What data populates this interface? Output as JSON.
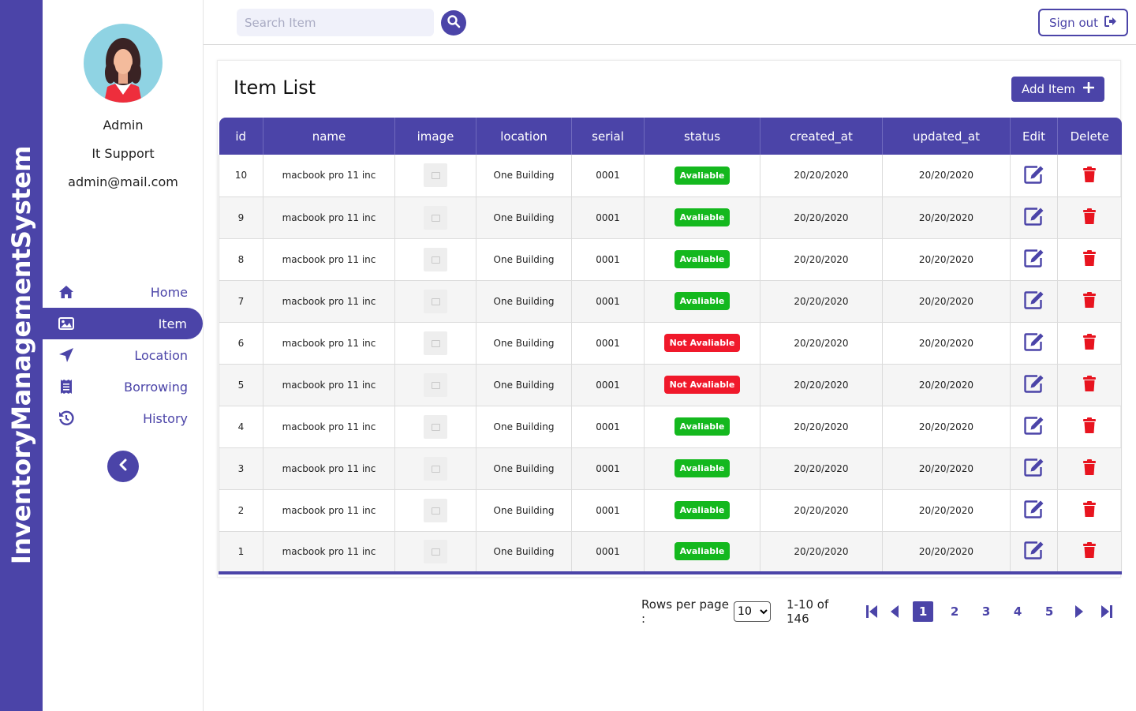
{
  "brand": {
    "name": "InventoryManagementSystem"
  },
  "profile": {
    "name": "Admin",
    "role": "It Support",
    "email": "admin@mail.com"
  },
  "sidebar": {
    "items": [
      {
        "label": "Home",
        "icon": "home-icon"
      },
      {
        "label": "Item",
        "icon": "image-icon",
        "active": true
      },
      {
        "label": "Location",
        "icon": "location-arrow-icon"
      },
      {
        "label": "Borrowing",
        "icon": "receipt-icon"
      },
      {
        "label": "History",
        "icon": "history-icon"
      }
    ]
  },
  "header": {
    "search_placeholder": "Search Item",
    "signout_label": "Sign out"
  },
  "main": {
    "title": "Item List",
    "add_label": "Add Item",
    "columns": [
      "id",
      "name",
      "image",
      "location",
      "serial",
      "status",
      "created_at",
      "updated_at",
      "Edit",
      "Delete"
    ],
    "rows": [
      {
        "id": "10",
        "name": "macbook pro 11 inc",
        "location": "One Building",
        "serial": "0001",
        "status": "Avaliable",
        "available": true,
        "created_at": "20/20/2020",
        "updated_at": "20/20/2020"
      },
      {
        "id": "9",
        "name": "macbook pro 11 inc",
        "location": "One Building",
        "serial": "0001",
        "status": "Avaliable",
        "available": true,
        "created_at": "20/20/2020",
        "updated_at": "20/20/2020"
      },
      {
        "id": "8",
        "name": "macbook pro 11 inc",
        "location": "One Building",
        "serial": "0001",
        "status": "Avaliable",
        "available": true,
        "created_at": "20/20/2020",
        "updated_at": "20/20/2020"
      },
      {
        "id": "7",
        "name": "macbook pro 11 inc",
        "location": "One Building",
        "serial": "0001",
        "status": "Avaliable",
        "available": true,
        "created_at": "20/20/2020",
        "updated_at": "20/20/2020"
      },
      {
        "id": "6",
        "name": "macbook pro 11 inc",
        "location": "One Building",
        "serial": "0001",
        "status": "Not Avaliable",
        "available": false,
        "created_at": "20/20/2020",
        "updated_at": "20/20/2020"
      },
      {
        "id": "5",
        "name": "macbook pro 11 inc",
        "location": "One Building",
        "serial": "0001",
        "status": "Not Avaliable",
        "available": false,
        "created_at": "20/20/2020",
        "updated_at": "20/20/2020"
      },
      {
        "id": "4",
        "name": "macbook pro 11 inc",
        "location": "One Building",
        "serial": "0001",
        "status": "Avaliable",
        "available": true,
        "created_at": "20/20/2020",
        "updated_at": "20/20/2020"
      },
      {
        "id": "3",
        "name": "macbook pro 11 inc",
        "location": "One Building",
        "serial": "0001",
        "status": "Avaliable",
        "available": true,
        "created_at": "20/20/2020",
        "updated_at": "20/20/2020"
      },
      {
        "id": "2",
        "name": "macbook pro 11 inc",
        "location": "One Building",
        "serial": "0001",
        "status": "Avaliable",
        "available": true,
        "created_at": "20/20/2020",
        "updated_at": "20/20/2020"
      },
      {
        "id": "1",
        "name": "macbook pro 11 inc",
        "location": "One Building",
        "serial": "0001",
        "status": "Avaliable",
        "available": true,
        "created_at": "20/20/2020",
        "updated_at": "20/20/2020"
      }
    ]
  },
  "pagination": {
    "rows_per_page_label": "Rows per page :",
    "rows_per_page": "10",
    "range": "1-10 of 146",
    "pages": [
      "1",
      "2",
      "3",
      "4",
      "5"
    ],
    "current_page": "1"
  },
  "colors": {
    "primary": "#4b44a8",
    "available": "#14b81e",
    "not_available": "#f0192b",
    "delete": "#e8141f"
  }
}
